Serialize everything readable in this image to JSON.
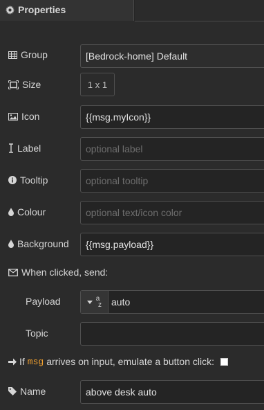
{
  "tab": {
    "label": "Properties",
    "icon": "gear-icon"
  },
  "fields": {
    "group": {
      "label": "Group",
      "icon": "table-icon",
      "value": "[Bedrock-home] Default"
    },
    "size": {
      "label": "Size",
      "icon": "resize-icon",
      "value": "1 x 1"
    },
    "icon": {
      "label": "Icon",
      "icon": "image-icon",
      "value": "{{msg.myIcon}}"
    },
    "label": {
      "label": "Label",
      "icon": "text-cursor-icon",
      "value": "",
      "placeholder": "optional label"
    },
    "tooltip": {
      "label": "Tooltip",
      "icon": "info-circle-icon",
      "value": "",
      "placeholder": "optional tooltip"
    },
    "colour": {
      "label": "Colour",
      "icon": "tint-icon",
      "value": "",
      "placeholder": "optional text/icon color"
    },
    "background": {
      "label": "Background",
      "icon": "tint-icon",
      "value": "{{msg.payload}}"
    }
  },
  "when_clicked": {
    "label": "When clicked, send:",
    "icon": "envelope-icon",
    "payload": {
      "label": "Payload",
      "type_icon": "string-type-icon",
      "type_glyph_top": "a",
      "type_glyph_bottom": "z",
      "value": "auto"
    },
    "topic": {
      "label": "Topic",
      "value": ""
    }
  },
  "emulate": {
    "icon": "arrow-right-icon",
    "prefix": "If",
    "code": "msg",
    "suffix": "arrives on input, emulate a button click:",
    "checked": false
  },
  "name": {
    "label": "Name",
    "icon": "tag-icon",
    "value": "above desk auto"
  },
  "colors": {
    "accent": "#f0a030",
    "background": "#2b2b2b",
    "input_bg": "#242424",
    "border": "#505050"
  }
}
